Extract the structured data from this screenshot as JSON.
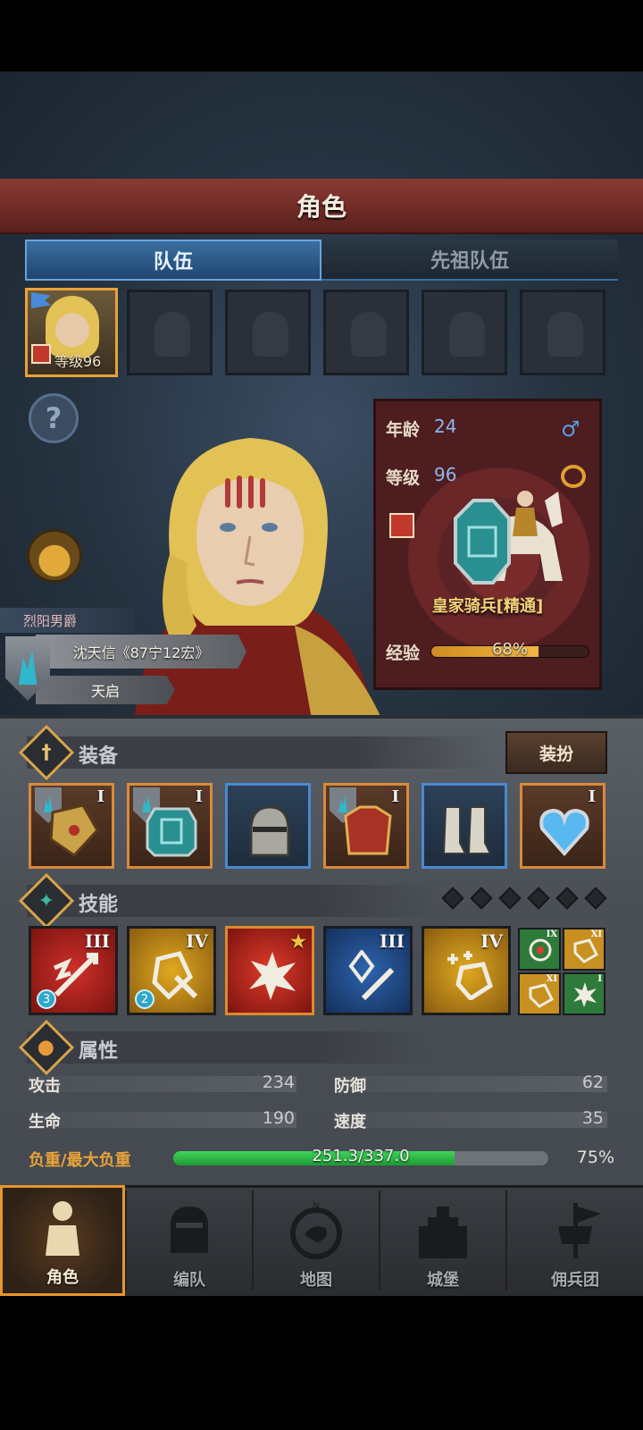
{
  "header": {
    "title": "角色"
  },
  "tabs": {
    "team": "队伍",
    "ancestor_team": "先祖队伍"
  },
  "hero_slot": {
    "level_label": "等级96"
  },
  "character": {
    "title": "烈阳男爵",
    "name": "沈天信《87宁12宏》",
    "faction": "天启"
  },
  "info": {
    "age_label": "年龄",
    "age_value": "24",
    "level_label": "等级",
    "level_value": "96",
    "unit_name": "皇家骑兵[精通]",
    "exp_label": "经验",
    "exp_text": "68%",
    "exp_fraction": 0.68,
    "gender_icon": "male-icon",
    "ring_icon": "ring-icon"
  },
  "equipment": {
    "title": "装备",
    "dress_button": "装扮",
    "slots": [
      {
        "tier": "I",
        "item": "gauntlet"
      },
      {
        "tier": "I",
        "item": "shield"
      },
      {
        "tier": "",
        "item": "helmet"
      },
      {
        "tier": "I",
        "item": "armor"
      },
      {
        "tier": "",
        "item": "boots"
      },
      {
        "tier": "I",
        "item": "amulet"
      }
    ]
  },
  "skills": {
    "title": "技能",
    "items": [
      {
        "tier": "III",
        "gem": "3"
      },
      {
        "tier": "IV",
        "gem": "2"
      },
      {
        "tier": "★",
        "gem": ""
      },
      {
        "tier": "III",
        "gem": ""
      },
      {
        "tier": "IV",
        "gem": ""
      }
    ],
    "mini": [
      {
        "tier": "IX"
      },
      {
        "tier": "XI"
      },
      {
        "tier": "XI"
      },
      {
        "tier": "I"
      }
    ]
  },
  "attributes": {
    "title": "属性",
    "attack_label": "攻击",
    "attack_value": "234",
    "defense_label": "防御",
    "defense_value": "62",
    "hp_label": "生命",
    "hp_value": "190",
    "speed_label": "速度",
    "speed_value": "35",
    "load_label": "负重/最大负重",
    "load_text": "251.3/337.0",
    "load_pct": "75%",
    "load_fraction": 0.75
  },
  "nav": {
    "character": "角色",
    "formation": "编队",
    "map": "地图",
    "castle": "城堡",
    "mercenary": "佣兵团"
  },
  "colors": {
    "accent_orange": "#e8a23a",
    "tab_blue": "#3b6fa0",
    "banner_red": "#6e2a25",
    "load_green": "#3fd35a"
  }
}
